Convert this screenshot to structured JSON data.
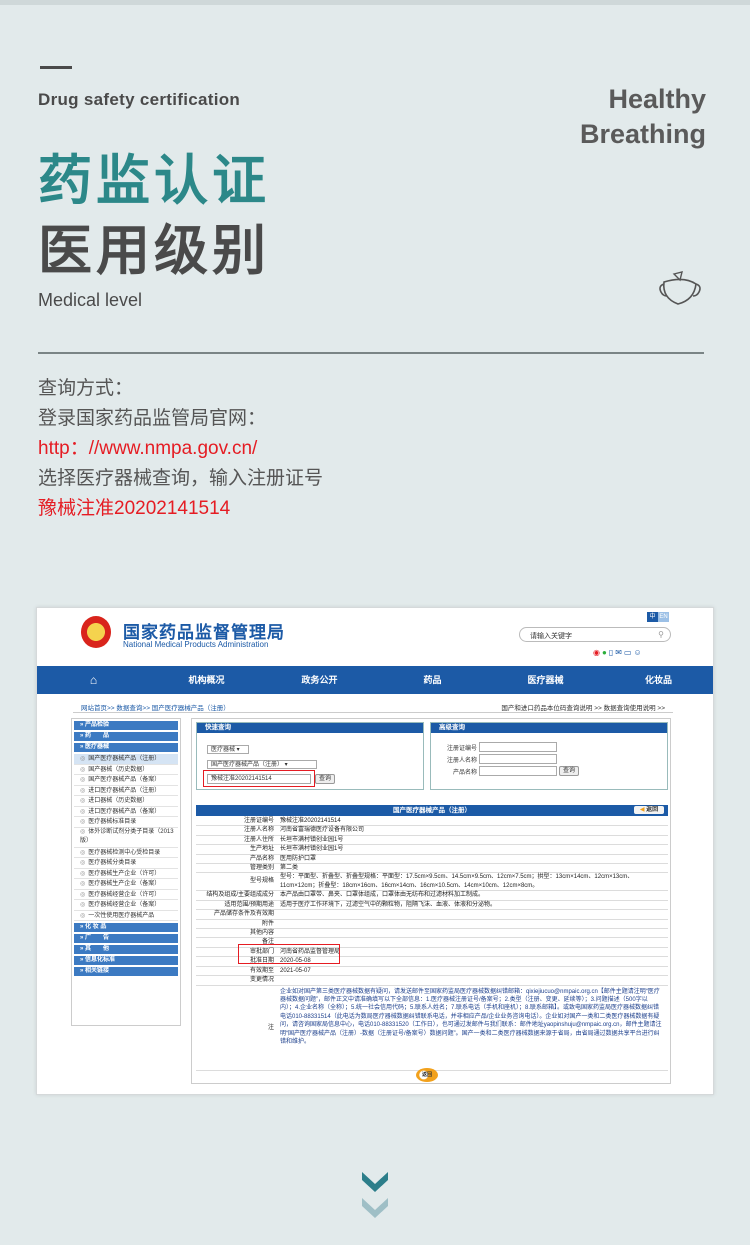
{
  "header": {
    "eyebrow": "Drug safety certification",
    "title_line1": "药监认证",
    "title_line2": "医用级别",
    "subtitle": "Medical level",
    "side_line1": "Healthy",
    "side_line2": "Breathing",
    "icon": "mask-icon"
  },
  "query": {
    "line1": "查询方式：",
    "line2": "登录国家药品监管局官网：",
    "url": "http：//www.nmpa.gov.cn/",
    "line4": "选择医疗器械查询，输入注册证号",
    "reg_no": "豫械注准20202141514"
  },
  "colors": {
    "accent": "#2c8889",
    "highlight": "#e51c23",
    "nav_blue": "#1c5aa6",
    "background": "#e2eaeb"
  },
  "site": {
    "name_cn": "国家药品监督管理局",
    "name_en": "National Medical Products Administration",
    "lang_cn": "中",
    "lang_en": "EN",
    "search_placeholder": "请输入关键字",
    "nav": [
      "",
      "机构概况",
      "政务公开",
      "药品",
      "医疗器械",
      "化妆品"
    ],
    "breadcrumb": "网站首页>> 数据查询>> 国产医疗器械产品（注册）",
    "breadcrumb_right": "国产和进口药品本位码查询说明 >>    数据查询使用说明 >>",
    "sidebar": {
      "cat1": "» 产品检验",
      "cat2": "» 药　　品",
      "cat3": "» 医疗器械",
      "items": [
        "国产医疗器械产品（注册）",
        "国产器械（历史数据）",
        "国产医疗器械产品（备案）",
        "进口医疗器械产品（注册）",
        "进口器械（历史数据）",
        "进口医疗器械产品（备案）",
        "医疗器械标准目录",
        "体外诊断试剂分类子目录（2013版）",
        "医疗器械检测中心受检目录",
        "医疗器械分类目录",
        "医疗器械生产企业（许可）",
        "医疗器械生产企业（备案）",
        "医疗器械经营企业（许可）",
        "医疗器械经营企业（备案）",
        "一次性使用医疗器械产品"
      ],
      "cat4": "» 化 妆 品",
      "cat5": "» 广　　告",
      "cat6": "» 其　　他",
      "cat7": "» 信息化标准",
      "cat8": "» 相关链接"
    },
    "quick": {
      "title": "快速查询",
      "select1": "医疗器械",
      "select2": "国产医疗器械产品（注册）",
      "input": "豫械注准20202141514",
      "button": "查询"
    },
    "advanced": {
      "title": "高级查询",
      "label1": "注册证编号",
      "label2": "注册人名称",
      "label3": "产品名称",
      "button": "查询"
    },
    "record": {
      "title": "国产医疗器械产品（注册）",
      "back": "返回",
      "return": "返回",
      "rows": [
        {
          "k": "注册证编号",
          "v": "豫械注准20202141514"
        },
        {
          "k": "注册人名称",
          "v": "河南省富瑞德医疗设备有限公司"
        },
        {
          "k": "注册人住所",
          "v": "长垣市满村镇创业园1号"
        },
        {
          "k": "生产地址",
          "v": "长垣市满村镇创业园1号"
        },
        {
          "k": "产品名称",
          "v": "医用防护口罩"
        },
        {
          "k": "管理类别",
          "v": "第二类"
        },
        {
          "k": "型号规格",
          "v": "型号：平面型、折叠型、折叠型规格：平面型：17.5cm×9.5cm、14.5cm×9.5cm、12cm×7.5cm；拱型：13cm×14cm、12cm×13cm、11cm×12cm；折叠型：18cm×16cm、16cm×14cm、16cm×10.5cm、14cm×10cm、12cm×8cm。"
        },
        {
          "k": "结构及组成/主要组成成分",
          "v": "本产品由口罩带、鼻夹、口罩体组成，口罩体由无纺布和过滤材料加工制成。"
        },
        {
          "k": "适用范围/预期用途",
          "v": "适用于医疗工作环境下，过滤空气中的颗粒物，阻隔飞沫、血液、体液和分泌物。"
        },
        {
          "k": "产品储存条件及有效期",
          "v": ""
        },
        {
          "k": "附件",
          "v": ""
        },
        {
          "k": "其他内容",
          "v": ""
        },
        {
          "k": "备注",
          "v": ""
        },
        {
          "k": "审批部门",
          "v": "河南省药品监督管理局"
        },
        {
          "k": "批准日期",
          "v": "2020-05-08"
        },
        {
          "k": "有效期至",
          "v": "2021-05-07"
        },
        {
          "k": "变更情况",
          "v": ""
        }
      ],
      "note_key": "注",
      "note": "企业如对国产第三类医疗器械数据有疑问，请发送邮件至国家药监局医疗器械数据纠错邮箱：qixiejiucuo@nmpaic.org.cn【邮件主题请注明“医疗器械数据问题”，邮件正文中请准确填写以下全部信息：1.医疗器械注册证号/备案号；2.类型（注册、变更、延续等）；3.问题描述（500字以内）；4.企业名称（全称）；5.统一社会信用代码；5.联系人姓名；7.联系电话（手机和座机）；8.联系邮箱】。或致电国家药监局医疗器械数据纠错电话010-88331514（此电话为数局医疗器械数据纠错联系电话，并非相应产品/企业业务咨询电话）。企业如对国产一类和二类医疗器械数据有疑问，请咨询国家局信息中心，电话010-88331520（工作日），也可通过发邮件与我们联系：邮件地址yaopinshuju@nmpaic.org.cn，邮件主题请注明“国产医疗器械产品（注册）-数据（注册证号/备案号）数据问题”。国产一类和二类医疗器械数据来源于省局，由省局通过数据共享平台进行纠错和维护。"
    }
  }
}
